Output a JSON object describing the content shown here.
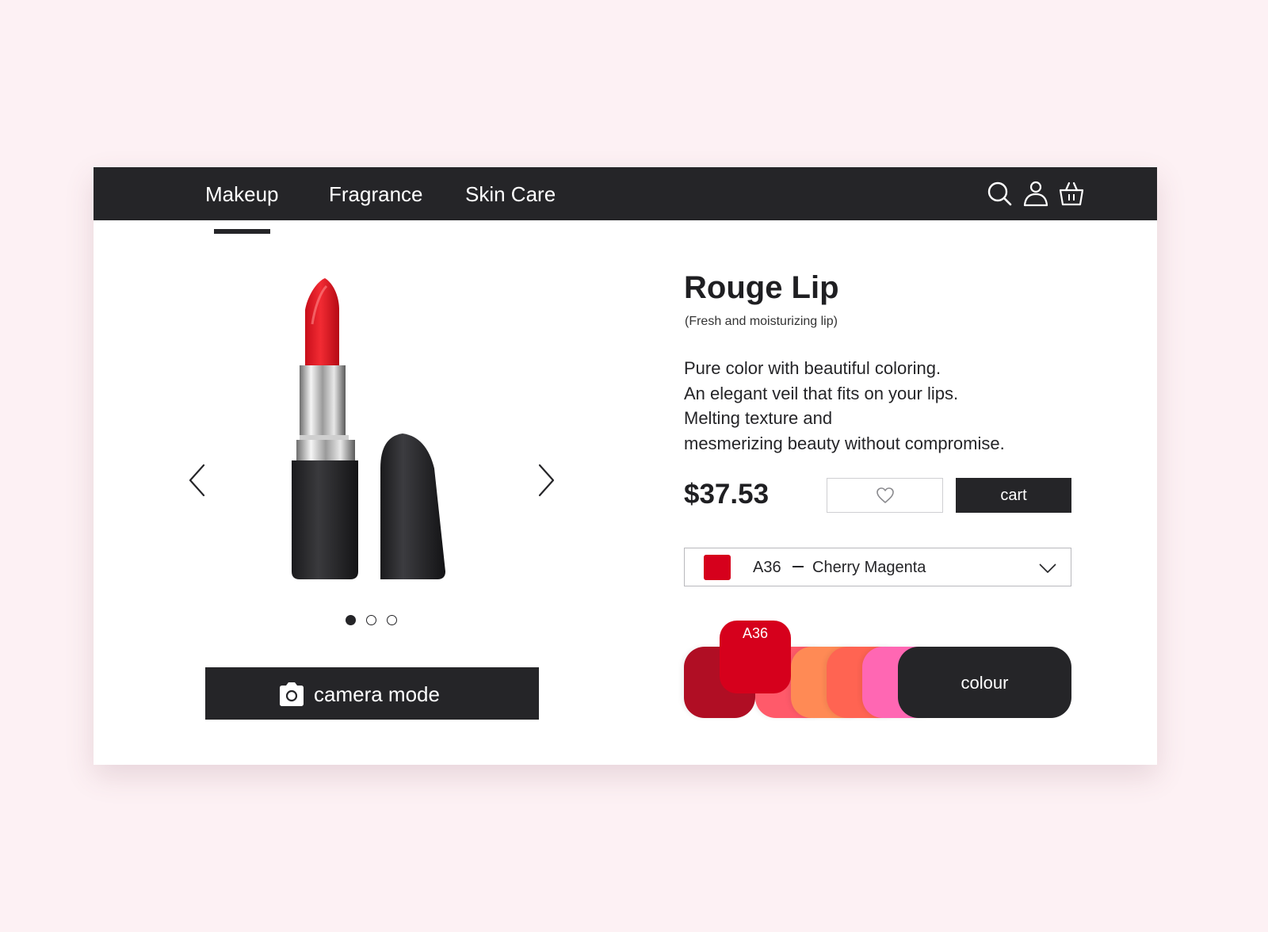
{
  "nav": {
    "items": [
      {
        "label": "Makeup",
        "active": true
      },
      {
        "label": "Fragrance",
        "active": false
      },
      {
        "label": "Skin Care",
        "active": false
      }
    ],
    "icons": [
      "search-icon",
      "user-icon",
      "shopping-bag-icon"
    ]
  },
  "gallery": {
    "slides": 3,
    "active_slide": 1,
    "camera_label": "camera mode"
  },
  "product": {
    "name": "Rouge Lip",
    "subtitle": "(Fresh and moisturizing lip)",
    "description": [
      "Pure color with beautiful coloring.",
      "An elegant veil that fits on your lips.",
      "Melting texture and",
      "mesmerizing beauty without compromise."
    ],
    "price": "$37.53",
    "cart_label": "cart"
  },
  "shade": {
    "code": "A36",
    "name": "Cherry Magenta",
    "color": "#d6001c"
  },
  "palette": {
    "selected_label": "A36",
    "colour_label": "colour",
    "swatches": [
      "#b00e24",
      "#d6001c",
      "#ff5a6a",
      "#ff8a55",
      "#ff6452",
      "#ff67b3"
    ]
  },
  "colors": {
    "dark": "#252528",
    "background": "#fdf1f4"
  }
}
